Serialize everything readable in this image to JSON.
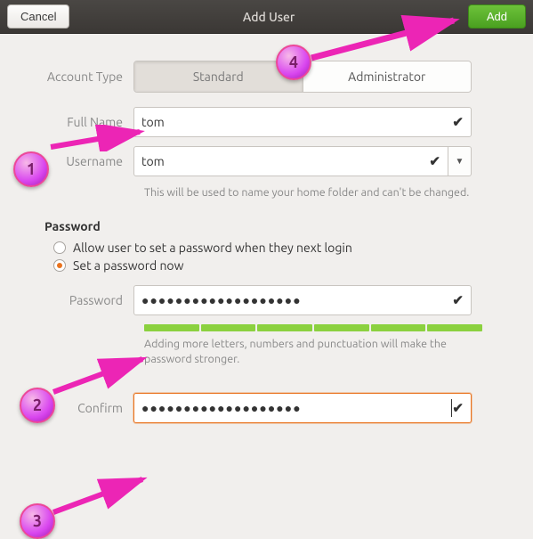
{
  "titlebar": {
    "cancel_label": "Cancel",
    "title": "Add User",
    "add_label": "Add"
  },
  "account_type": {
    "label": "Account Type",
    "standard": "Standard",
    "administrator": "Administrator"
  },
  "full_name": {
    "label": "Full Name",
    "value": "tom"
  },
  "username": {
    "label": "Username",
    "value": "tom",
    "helper": "This will be used to name your home folder and can't be changed."
  },
  "password_section": {
    "title": "Password",
    "radio_next_login": "Allow user to set a password when they next login",
    "radio_now": "Set a password now",
    "password_label": "Password",
    "password_value": "●●●●●●●●●●●●●●●●●●●",
    "strength_helper": "Adding more letters, numbers and punctuation will make the password stronger.",
    "confirm_label": "Confirm",
    "confirm_value": "●●●●●●●●●●●●●●●●●●●"
  },
  "annotations": {
    "n1": "1",
    "n2": "2",
    "n3": "3",
    "n4": "4"
  }
}
